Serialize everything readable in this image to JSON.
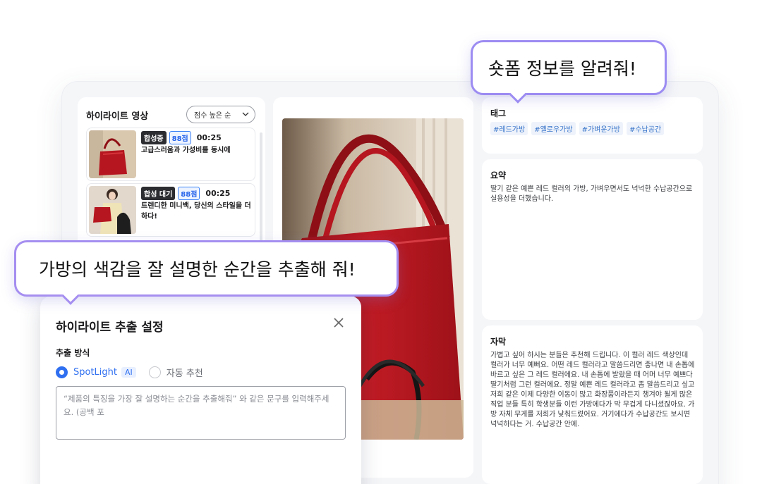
{
  "left_panel": {
    "title": "하이라이트 영상",
    "sort": "점수 높은 순",
    "items": [
      {
        "status": "합성중",
        "score": "88점",
        "duration": "00:25",
        "title": "고급스러움과 가성비를 동시에"
      },
      {
        "status": "합성 대기",
        "score": "88점",
        "duration": "00:25",
        "title": "트렌디한 미니백, 당신의 스타일을 더하다!"
      }
    ]
  },
  "right_panel": {
    "tags_title": "태그",
    "tags": [
      "#레드가방",
      "#옐로우가방",
      "#가벼운가방",
      "#수납공간"
    ],
    "summary_title": "요약",
    "summary": "딸기 같은 예쁜 레드 컬러의 가방, 가벼우면서도 넉넉한 수납공간으로 실용성을 더했습니다.",
    "caption_title": "자막",
    "caption": "가볍고 싶어 하시는 분들은 추천해 드립니다. 이 컬러 레드 색상인데 컬러가 너무 예뻐요. 어떤 레드 컬러라고 말씀드리면 좋나면 내 손톱에 바르고 싶은 그 레드 컬러에요. 내 손톱에 발랐을 때 어머 너무 예쁘다 딸기처럼 그런 컬러에요. 정말 예쁜 레드 컬러라고 좀 말씀드리고 싶고 저희 같은 이제 다양한 이동이 많고 화장품이라든지 챙겨야 될게 많은 직업 분들 특히 학생분들 이런 가방에다가 막 무겁게 다니셨잖아요. 가방 자체 무게를 저희가 낮춰드렸어요. 거기에다가 수납공간도 보시면 넉넉하다는 거. 수납공간 안에."
  },
  "bubbles": {
    "top": "숏폼 정보를 알려줘!",
    "bottom": "가방의 색감을 잘 설명한 순간을 추출해 줘!"
  },
  "modal": {
    "title": "하이라이트 추출 설정",
    "method_label": "추출 방식",
    "option_selected": "SpotLight",
    "option_selected_badge": "AI",
    "option_other": "자동 추천",
    "prompt_placeholder": "“제품의 특징을 가장 잘 설명하는 순간을 추출해줘” 와 같은 문구를 입력해주세요. (공백 포"
  },
  "colors": {
    "accent": "#2f6ff0",
    "bubble_border": "#9c8cf2",
    "bag_red": "#b5161f"
  }
}
